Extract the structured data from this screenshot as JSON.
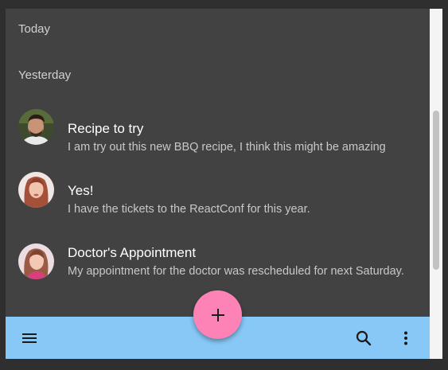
{
  "inbox": {
    "sections": {
      "today": "Today",
      "yesterday": "Yesterday"
    },
    "items": [
      {
        "title": "Recipe to try",
        "body": "I am try out this new BBQ recipe, I think this might be amazing",
        "avatar": "man-with-beard-avatar"
      },
      {
        "title": "Yes!",
        "body": "I have the tickets to the ReactConf for this year.",
        "avatar": "woman-long-hair-avatar"
      },
      {
        "title": "Doctor's Appointment",
        "body": "My appointment for the doctor was rescheduled for next Saturday.",
        "avatar": "woman-pink-avatar"
      }
    ]
  },
  "bottom_bar": {
    "left_icon": "menu-icon",
    "right_icons": [
      "search-icon",
      "more-vert-icon"
    ],
    "fab_icon": "add-icon"
  },
  "colors": {
    "surface": "#424242",
    "bottom_bar": "#87c8f7",
    "fab": "#fd83b6"
  }
}
